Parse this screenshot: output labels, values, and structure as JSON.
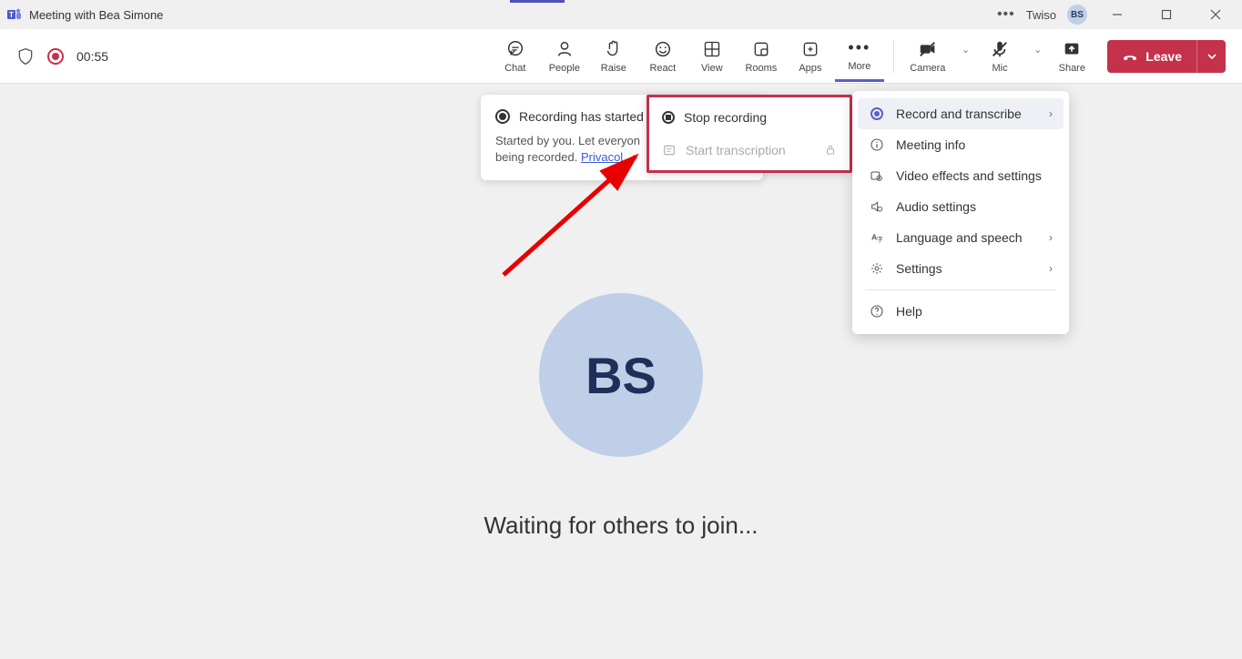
{
  "titlebar": {
    "title": "Meeting with Bea Simone",
    "account": "Twiso",
    "user_initials": "BS"
  },
  "toolbar": {
    "timer": "00:55",
    "buttons": {
      "chat": "Chat",
      "people": "People",
      "raise": "Raise",
      "react": "React",
      "view": "View",
      "rooms": "Rooms",
      "apps": "Apps",
      "more": "More",
      "camera": "Camera",
      "mic": "Mic",
      "share": "Share"
    },
    "leave": "Leave"
  },
  "main": {
    "avatar_initials": "BS",
    "waiting": "Waiting for others to join..."
  },
  "toast": {
    "title": "Recording has started",
    "body_part1": "Started by you. Let everyon",
    "body_part2": "being recorded. ",
    "link": "Privac",
    "link_tail": "ol"
  },
  "submenu": {
    "stop": "Stop recording",
    "transcribe": "Start transcription"
  },
  "more_menu": {
    "record": "Record and transcribe",
    "info": "Meeting info",
    "video": "Video effects and settings",
    "audio": "Audio settings",
    "language": "Language and speech",
    "settings": "Settings",
    "help": "Help"
  }
}
